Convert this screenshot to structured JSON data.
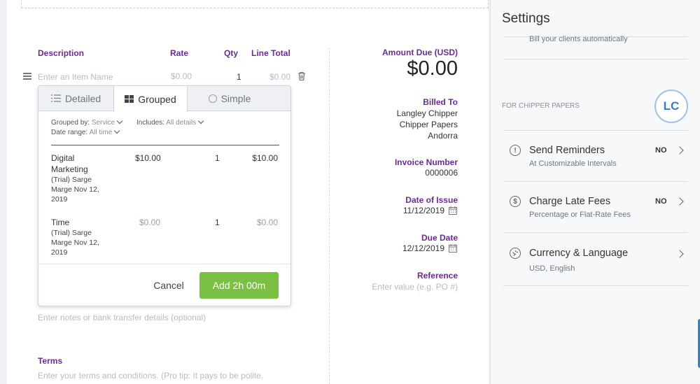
{
  "items_table": {
    "headers": {
      "description": "Description",
      "rate": "Rate",
      "qty": "Qty",
      "line_total": "Line Total"
    },
    "new_row": {
      "name_placeholder": "Enter an Item Name",
      "rate": "$0.00",
      "qty": "1",
      "total": "$0.00"
    }
  },
  "popover": {
    "tabs": [
      {
        "label": "Detailed",
        "icon": "list-icon"
      },
      {
        "label": "Grouped",
        "icon": "grid-icon"
      },
      {
        "label": "Simple",
        "icon": "radio-icon"
      }
    ],
    "filters": {
      "grouped_by_label": "Grouped by:",
      "grouped_by_value": "Service",
      "includes_label": "Includes:",
      "includes_value": "All details",
      "date_range_label": "Date range:",
      "date_range_value": "All time"
    },
    "rows": [
      {
        "name": "Digital",
        "name2": "Marketing",
        "detail": "(Trial) Sarge",
        "detail2": "Marge Nov 12,",
        "detail3": "2019",
        "rate": "$10.00",
        "qty": "1",
        "total": "$10.00"
      },
      {
        "name": "Time",
        "detail": "(Trial) Sarge",
        "detail2": "Marge Nov 12,",
        "detail3": "2019",
        "rate": "$0.00",
        "qty": "1",
        "total": "$0.00"
      }
    ],
    "cancel_label": "Cancel",
    "add_label": "Add 2h 00m"
  },
  "notes_placeholder": "Enter notes or bank transfer details (optional)",
  "terms": {
    "label": "Terms",
    "placeholder": "Enter your terms and conditions. (Pro tip: It pays to be polite."
  },
  "summary": {
    "amount_due_label": "Amount Due (USD)",
    "amount_due": "$0.00",
    "billed_to_label": "Billed To",
    "billed_to": [
      "Langley Chipper",
      "Chipper Papers",
      "Andorra"
    ],
    "invoice_number_label": "Invoice Number",
    "invoice_number": "0000006",
    "date_of_issue_label": "Date of Issue",
    "date_of_issue": "11/12/2019",
    "due_date_label": "Due Date",
    "due_date": "12/12/2019",
    "reference_label": "Reference",
    "reference_placeholder": "Enter value (e.g. PO #)"
  },
  "settings": {
    "title": "Settings",
    "bill_auto": "Bill your clients automatically",
    "for_label": "FOR CHIPPER PAPERS",
    "avatar": "LC",
    "items": [
      {
        "title": "Send Reminders",
        "subtitle": "At Customizable Intervals",
        "status": "NO",
        "icon": "clock-icon"
      },
      {
        "title": "Charge Late Fees",
        "subtitle": "Percentage or Flat-Rate Fees",
        "status": "NO",
        "icon": "dollar-clock-icon"
      },
      {
        "title": "Currency & Language",
        "subtitle": "USD, English",
        "status": "",
        "icon": "globe-icon"
      }
    ]
  },
  "colors": {
    "accent": "#6b2c91",
    "green": "#7ac143",
    "avatar_blue": "#3a7bc8"
  }
}
